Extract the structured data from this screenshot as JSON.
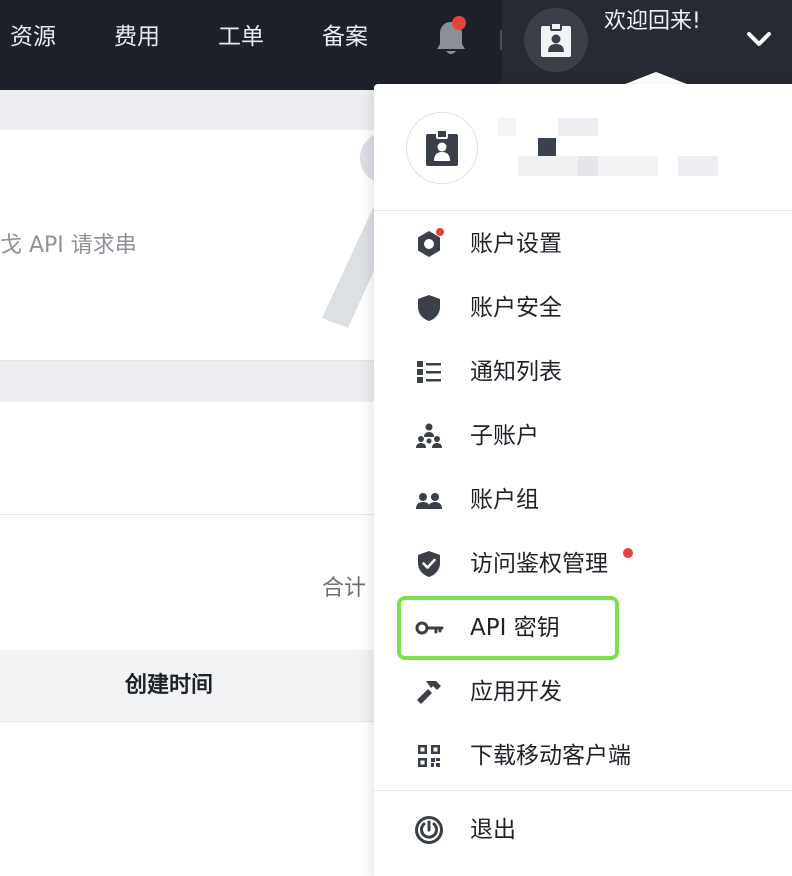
{
  "nav": {
    "items": [
      "资源",
      "费用",
      "工单",
      "备案"
    ],
    "welcome": "欢迎回来!"
  },
  "page": {
    "hero_text": "戈 API 请求串",
    "total_label": "合计",
    "table_header_created": "创建时间"
  },
  "dropdown": {
    "menu": [
      {
        "label": "账户设置",
        "icon": "gear-hex-icon"
      },
      {
        "label": "账户安全",
        "icon": "shield-icon"
      },
      {
        "label": "通知列表",
        "icon": "list-icon"
      },
      {
        "label": "子账户",
        "icon": "org-tree-icon"
      },
      {
        "label": "账户组",
        "icon": "group-icon"
      },
      {
        "label": "访问鉴权管理",
        "icon": "shield-check-icon"
      },
      {
        "label": "API 密钥",
        "icon": "key-icon"
      },
      {
        "label": "应用开发",
        "icon": "hammer-icon"
      },
      {
        "label": "下载移动客户端",
        "icon": "qrcode-icon"
      }
    ],
    "logout": {
      "label": "退出",
      "icon": "power-icon"
    }
  },
  "colors": {
    "nav_bg": "#1d2129",
    "notification_dot": "#e8423a",
    "highlight": "#7ee04c"
  }
}
